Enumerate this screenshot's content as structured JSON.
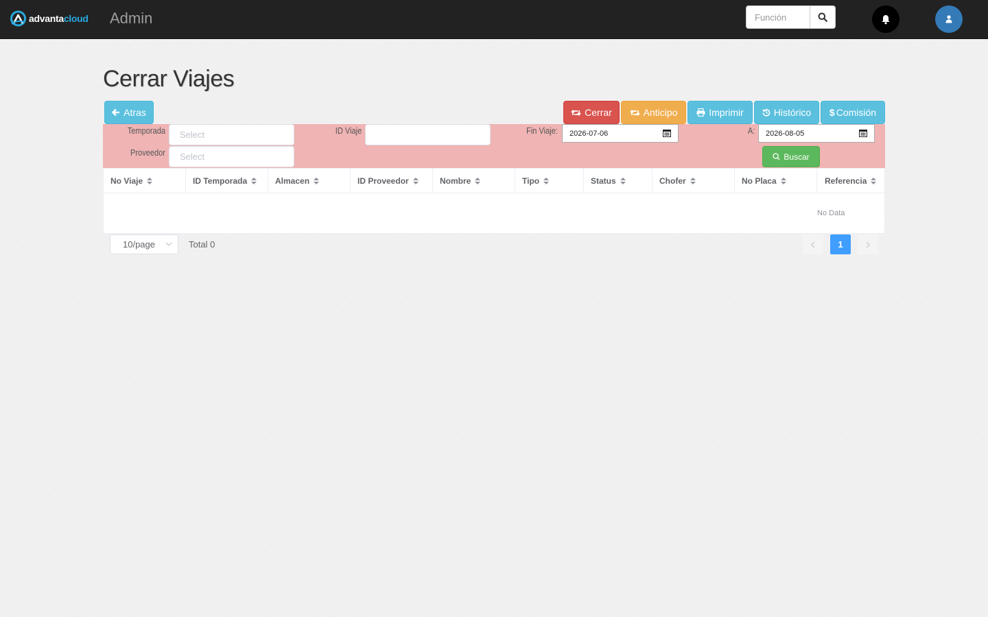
{
  "header": {
    "logo": {
      "text_part1": "advanta",
      "text_part2": "cloud",
      "icon": "advanta-logo-icon"
    },
    "brand": "Admin",
    "search": {
      "placeholder": "Función",
      "icon": "search-icon"
    },
    "notifications_icon": "bell-icon",
    "user_icon": "user-icon"
  },
  "page": {
    "title": "Cerrar Viajes"
  },
  "toolbar": {
    "back_label": "Atras",
    "close_label": "Cerrar",
    "advance_label": "Anticipo",
    "print_label": "Imprimir",
    "history_label": "Histórico",
    "commission_label": "Comisión"
  },
  "filters": {
    "season_label": "Temporada",
    "season_placeholder": "Select",
    "provider_label": "Proveedor",
    "provider_placeholder": "Select",
    "trip_id_label": "ID Viaje",
    "trip_id_value": "",
    "end_trip_label": "Fin Viaje:",
    "end_trip_from": "2026-07-06",
    "to_label": "A:",
    "end_trip_to": "2026-08-05",
    "search_label": "Buscar"
  },
  "table": {
    "columns": [
      "No Viaje",
      "ID Temporada",
      "Almacen",
      "ID Proveedor",
      "Nombre",
      "Tipo",
      "Status",
      "Chofer",
      "No Placa",
      "Referencia"
    ],
    "rows": [],
    "empty_text": "No Data"
  },
  "pagination": {
    "page_size": "10/page",
    "total": "Total 0",
    "current_page": "1"
  },
  "colors": {
    "topbar": "#222222",
    "filter_panel": "#f0b4b4",
    "info": "#5bc0de",
    "danger": "#d9534f",
    "warning": "#f0ad4e",
    "success": "#5cb85c",
    "active_page": "#409eff"
  }
}
